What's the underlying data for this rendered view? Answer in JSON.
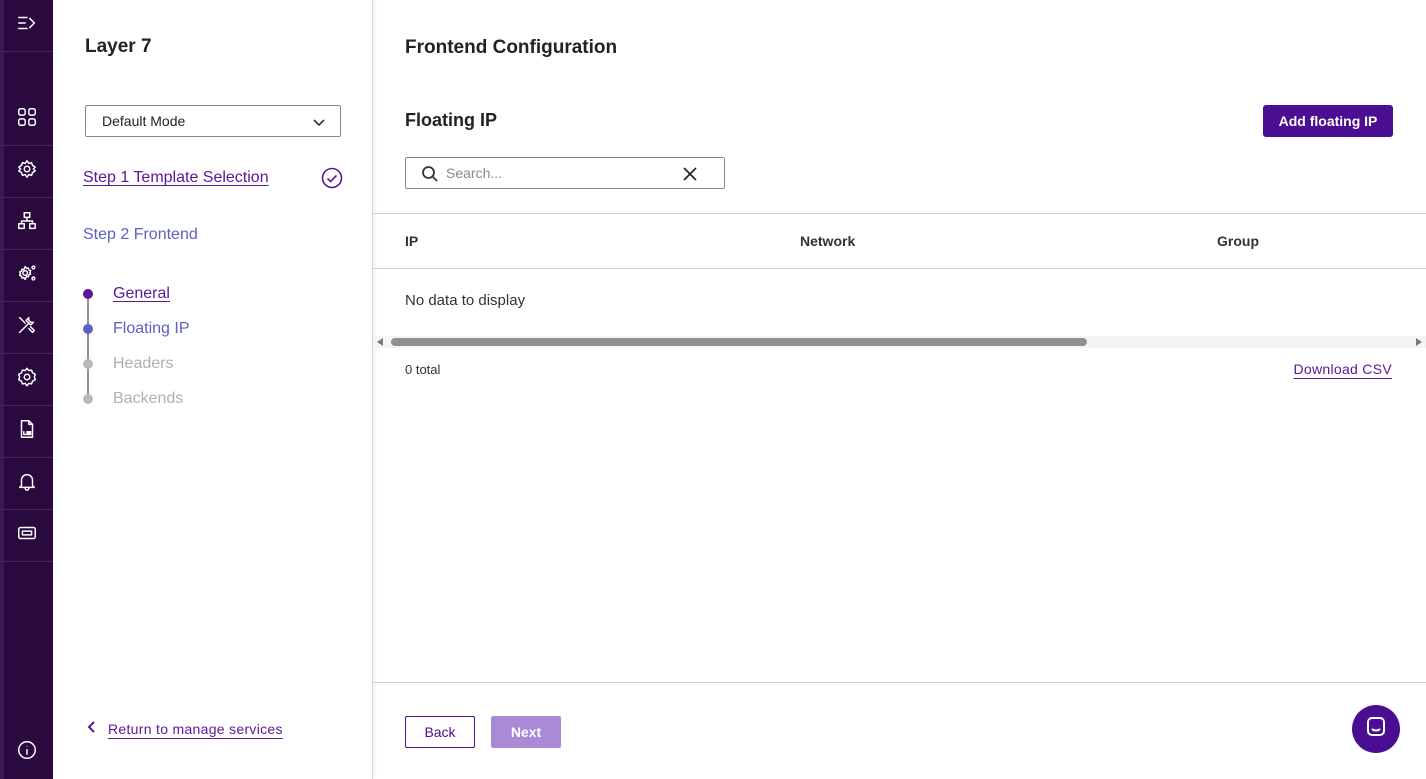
{
  "rail": {
    "items": [
      {
        "icon": "menu-expand-icon"
      },
      {
        "icon": "dashboard-grid-icon"
      },
      {
        "icon": "services-gear-icon"
      },
      {
        "icon": "network-topology-icon"
      },
      {
        "icon": "settings-cluster-icon"
      },
      {
        "icon": "tools-icon"
      },
      {
        "icon": "settings-gear-icon"
      },
      {
        "icon": "log-file-icon"
      },
      {
        "icon": "bell-icon"
      },
      {
        "icon": "ticket-icon"
      }
    ],
    "bottom_icon": "info-icon"
  },
  "steps_panel": {
    "title": "Layer 7",
    "mode_select": {
      "value": "Default Mode"
    },
    "step1": {
      "label": "Step 1 Template Selection",
      "completed": true
    },
    "step2": {
      "label": "Step 2 Frontend"
    },
    "substeps": [
      {
        "label": "General"
      },
      {
        "label": "Floating IP"
      },
      {
        "label": "Headers"
      },
      {
        "label": "Backends"
      }
    ],
    "return_link": "Return to manage services"
  },
  "main": {
    "page_title": "Frontend Configuration",
    "section_title": "Floating IP",
    "add_button": "Add floating IP",
    "search": {
      "placeholder": "Search...",
      "value": ""
    },
    "table": {
      "columns": [
        "IP",
        "Network",
        "Group"
      ],
      "rows": [],
      "empty_message": "No data to display"
    },
    "total": "0 total",
    "download_link": "Download CSV",
    "footer": {
      "back_label": "Back",
      "next_label": "Next"
    }
  },
  "colors": {
    "rail_bg": "#2a0a3e",
    "primary": "#4b0d91",
    "link": "#5a1796",
    "active_step": "#5b5fc7",
    "disabled_button": "#a88ad6"
  }
}
